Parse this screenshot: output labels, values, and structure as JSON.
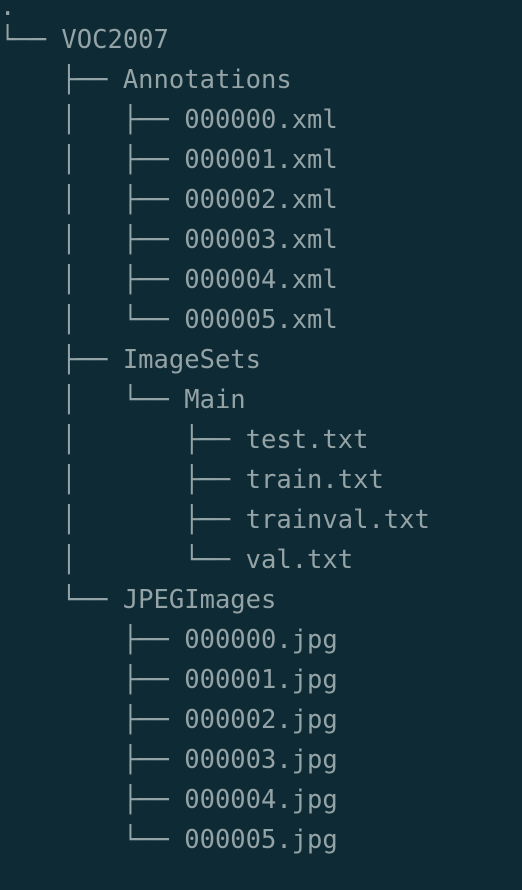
{
  "tree": {
    "root": ".",
    "lines": [
      {
        "prefix": "└── ",
        "name": "VOC2007"
      },
      {
        "prefix": "    ├── ",
        "name": "Annotations"
      },
      {
        "prefix": "    │   ├── ",
        "name": "000000.xml"
      },
      {
        "prefix": "    │   ├── ",
        "name": "000001.xml"
      },
      {
        "prefix": "    │   ├── ",
        "name": "000002.xml"
      },
      {
        "prefix": "    │   ├── ",
        "name": "000003.xml"
      },
      {
        "prefix": "    │   ├── ",
        "name": "000004.xml"
      },
      {
        "prefix": "    │   └── ",
        "name": "000005.xml"
      },
      {
        "prefix": "    ├── ",
        "name": "ImageSets"
      },
      {
        "prefix": "    │   └── ",
        "name": "Main"
      },
      {
        "prefix": "    │       ├── ",
        "name": "test.txt"
      },
      {
        "prefix": "    │       ├── ",
        "name": "train.txt"
      },
      {
        "prefix": "    │       ├── ",
        "name": "trainval.txt"
      },
      {
        "prefix": "    │       └── ",
        "name": "val.txt"
      },
      {
        "prefix": "    └── ",
        "name": "JPEGImages"
      },
      {
        "prefix": "        ├── ",
        "name": "000000.jpg"
      },
      {
        "prefix": "        ├── ",
        "name": "000001.jpg"
      },
      {
        "prefix": "        ├── ",
        "name": "000002.jpg"
      },
      {
        "prefix": "        ├── ",
        "name": "000003.jpg"
      },
      {
        "prefix": "        ├── ",
        "name": "000004.jpg"
      },
      {
        "prefix": "        └── ",
        "name": "000005.jpg"
      }
    ]
  },
  "colors": {
    "background": "#0e2a35",
    "text": "#94a3a6"
  }
}
